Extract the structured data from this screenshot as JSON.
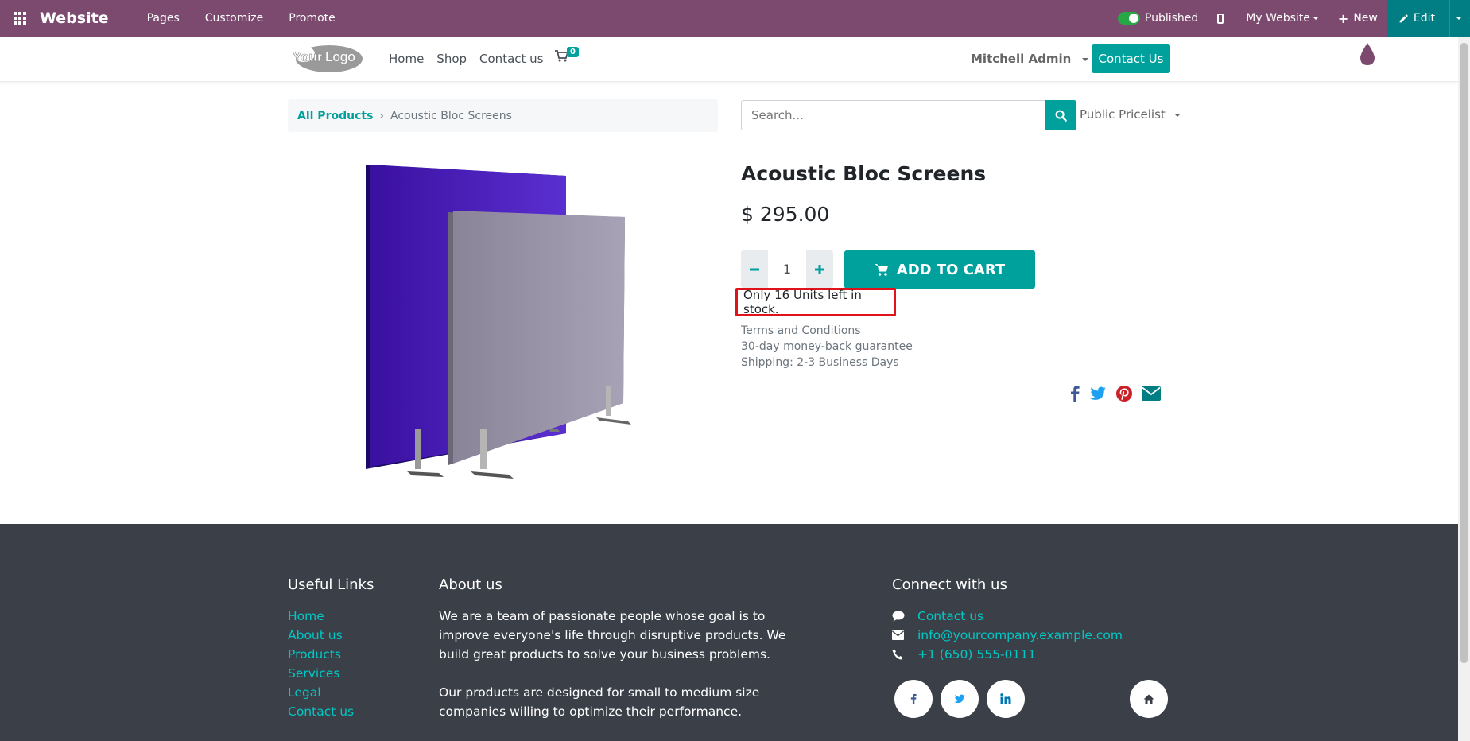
{
  "topbar": {
    "brand": "Website",
    "nav": [
      "Pages",
      "Customize",
      "Promote"
    ],
    "published_label": "Published",
    "website_label": "My Website",
    "new_label": "New",
    "edit_label": "Edit",
    "color": "#7c4a6e",
    "edit_color": "#017e84"
  },
  "header": {
    "logo_text": "YourLogo",
    "nav": [
      "Home",
      "Shop",
      "Contact us"
    ],
    "cart_count": "0",
    "user": "Mitchell Admin",
    "contact_button": "Contact Us",
    "accent_color": "#00a09d"
  },
  "breadcrumb": {
    "parent": "All Products",
    "current": "Acoustic Bloc Screens"
  },
  "search": {
    "placeholder": "Search..."
  },
  "pricelist": "Public Pricelist",
  "product": {
    "name": "Acoustic Bloc Screens",
    "price": "$ 295.00",
    "quantity": "1",
    "add_to_cart": "ADD TO CART",
    "stock_message": "Only 16 Units left in stock.",
    "terms": [
      "Terms and Conditions",
      "30-day money-back guarantee",
      "Shipping: 2-3 Business Days"
    ]
  },
  "share": [
    "facebook-icon",
    "twitter-icon",
    "pinterest-icon",
    "envelope-icon"
  ],
  "footer": {
    "useful_links_title": "Useful Links",
    "useful_links": [
      "Home",
      "About us",
      "Products",
      "Services",
      "Legal",
      "Contact us"
    ],
    "about_title": "About us",
    "about_p1": "We are a team of passionate people whose goal is to improve everyone's life through disruptive products. We build great products to solve your business problems.",
    "about_p2": "Our products are designed for small to medium size companies willing to optimize their performance.",
    "connect_title": "Connect with us",
    "contact_link": "Contact us",
    "email": "info@yourcompany.example.com",
    "phone": "+1 (650) 555-0111",
    "background": "#3a3f48"
  }
}
